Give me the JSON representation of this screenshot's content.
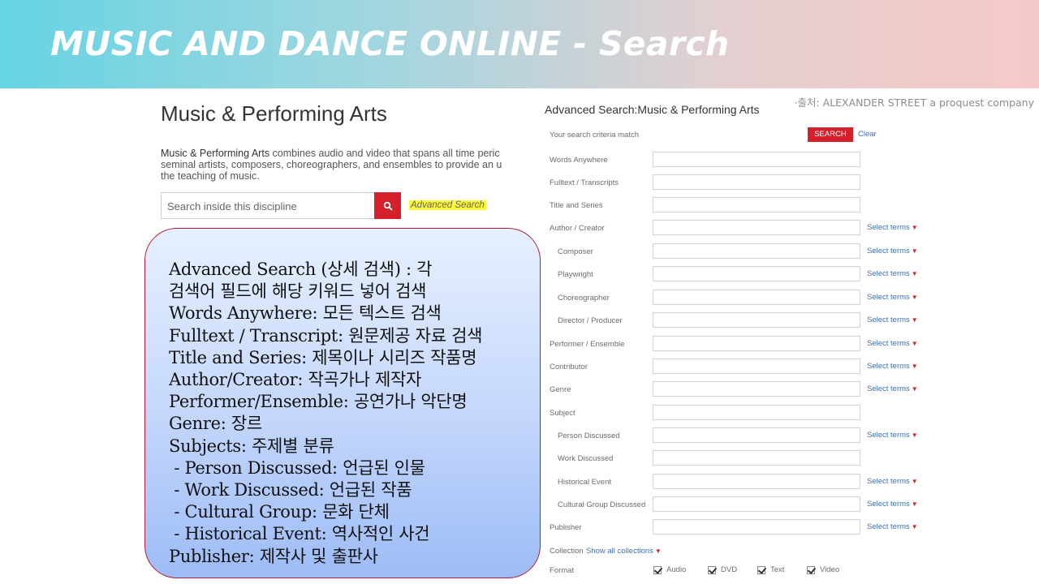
{
  "banner": {
    "title": "MUSIC AND DANCE ONLINE - Search"
  },
  "source_note": "·출처: ALEXANDER STREET a proquest company",
  "left_panel": {
    "title": "Music & Performing Arts",
    "desc_strong": "Music & Performing Arts",
    "desc_line1_rest": " combines audio and video that spans all time peric",
    "desc_line2": "seminal artists, composers, choreographers, and ensembles to provide an u",
    "desc_line3": "the teaching of music.",
    "search_placeholder": "Search inside this discipline",
    "advanced_search_label": "Advanced Search",
    "search_icon": "search-icon"
  },
  "callout": {
    "lines": [
      "Advanced Search (상세 검색) : 각",
      "검색어 필드에 해당 키워드 넣어 검색",
      "Words Anywhere: 모든 텍스트 검색",
      "Fulltext / Transcript: 원문제공 자료 검색",
      "Title and Series: 제목이나 시리즈 작품명",
      "Author/Creator: 작곡가나 제작자",
      "Performer/Ensemble: 공연가나 악단명",
      "Genre: 장르",
      "Subjects: 주제별 분류",
      " - Person Discussed: 언급된 인물",
      " - Work Discussed: 언급된 작품",
      " - Cultural Group: 문화 단체",
      " - Historical Event: 역사적인 사건",
      "Publisher: 제작사 및 출판사"
    ]
  },
  "form": {
    "title": "Advanced Search:Music & Performing Arts",
    "criteria_label": "Your search criteria match",
    "search_button": "SEARCH",
    "clear_label": "Clear",
    "select_terms_label": "Select terms",
    "fields": [
      {
        "label": "Words Anywhere",
        "select_terms": false
      },
      {
        "label": "Fulltext / Transcripts",
        "select_terms": false
      },
      {
        "label": "Title and Series",
        "select_terms": false
      },
      {
        "label": "Author / Creator",
        "select_terms": true
      },
      {
        "label": "Composer",
        "select_terms": true
      },
      {
        "label": "Playwright",
        "select_terms": true
      },
      {
        "label": "Choreographer",
        "select_terms": true
      },
      {
        "label": "Director / Producer",
        "select_terms": true
      },
      {
        "label": "Performer / Ensemble",
        "select_terms": true
      },
      {
        "label": "Contributor",
        "select_terms": true
      },
      {
        "label": "Genre",
        "select_terms": true
      },
      {
        "label": "Subject",
        "select_terms": false
      },
      {
        "label": "Person Discussed",
        "select_terms": true
      },
      {
        "label": "Work Discussed",
        "select_terms": false
      },
      {
        "label": "Historical Event",
        "select_terms": true
      },
      {
        "label": "Cultural Group Discussed",
        "select_terms": true
      },
      {
        "label": "Publisher",
        "select_terms": true
      }
    ],
    "collection_label": "Collection",
    "show_collections_label": "Show all collections",
    "format_label": "Format",
    "formats": [
      {
        "label": "Audio",
        "checked": true
      },
      {
        "label": "DVD",
        "checked": true
      },
      {
        "label": "Text",
        "checked": true
      },
      {
        "label": "Video",
        "checked": true
      }
    ]
  },
  "colors": {
    "accent_red": "#d3202a",
    "link_blue": "#3b6fb6",
    "highlight": "#fbf53a"
  }
}
